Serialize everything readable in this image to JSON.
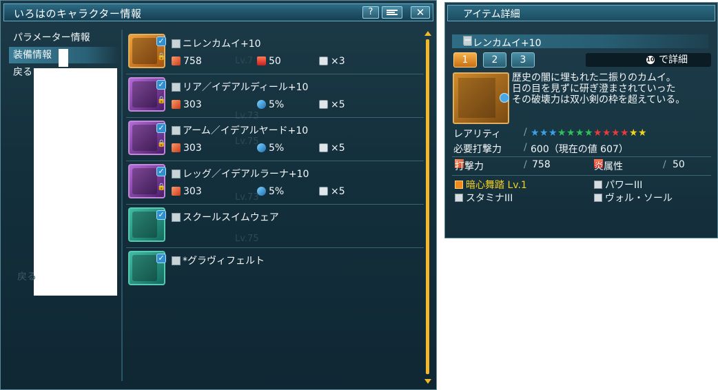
{
  "left_window": {
    "title": "いろはのキャラクター情報",
    "buttons": {
      "help": "?",
      "close": "✕"
    },
    "menu": [
      {
        "label": "パラメーター情報"
      },
      {
        "label": "装備情報"
      },
      {
        "label": "戻る"
      }
    ],
    "ghost_back": "戻る",
    "equipment": [
      {
        "name": "ニレンカムイ+10",
        "icon": "katana-icon",
        "frame": "orange",
        "stats": {
          "attack": "758",
          "element_value": "50",
          "slots": "×3"
        },
        "element_icon": "fire-icon"
      },
      {
        "name": "リア／イデアルディール+10",
        "icon": "rear-unit-icon",
        "frame": "purple",
        "stats": {
          "attack": "303",
          "element_value": "5%",
          "slots": "×5"
        },
        "element_icon": "resist-icon"
      },
      {
        "name": "アーム／イデアルヤード+10",
        "icon": "arm-unit-icon",
        "frame": "purple",
        "stats": {
          "attack": "303",
          "element_value": "5%",
          "slots": "×5"
        },
        "element_icon": "resist-icon"
      },
      {
        "name": "レッグ／イデアルラーナ+10",
        "icon": "leg-unit-icon",
        "frame": "purple",
        "stats": {
          "attack": "303",
          "element_value": "5%",
          "slots": "×5"
        },
        "element_icon": "resist-icon"
      },
      {
        "name": "スクールスイムウェア",
        "icon": "costume-icon",
        "frame": "teal"
      },
      {
        "name": "*グラヴィフェルト",
        "icon": "mag-icon",
        "frame": "teal"
      }
    ],
    "bg_levels": [
      "Lv.7",
      "Lv.73",
      "Lv.75",
      "Lv.73",
      "Lv.75"
    ]
  },
  "detail_window": {
    "title": "アイテム詳細",
    "item_name": "ニレンカムイ+10",
    "tabs": [
      "1",
      "2",
      "3"
    ],
    "detail_hint": "で詳細",
    "detail_badge": "10",
    "description": [
      "歴史の闇に埋もれた二振りのカムイ。",
      "日の目を見ずに研ぎ澄まされていった",
      "その破壊力は双小剣の枠を超えている。"
    ],
    "rarity_label": "レアリティ",
    "rarity": 13,
    "rarity_star_colors": [
      "#3aa0e8",
      "#3aa0e8",
      "#3aa0e8",
      "#2fc05a",
      "#2fc05a",
      "#2fc05a",
      "#2fc05a",
      "#e83a3a",
      "#e83a3a",
      "#e83a3a",
      "#e83a3a",
      "#f2d21e",
      "#f2d21e"
    ],
    "required_label": "必要打撃力",
    "required_value": "600（現在の値 607）",
    "attack_label": "打撃力",
    "attack_value": "758",
    "element_label": "炎属性",
    "element_value": "50",
    "abilities": [
      {
        "label": "暗心舞踏 Lv.1",
        "special": true
      },
      {
        "label": "パワーIII"
      },
      {
        "label": "スタミナIII"
      },
      {
        "label": "ヴォル・ソール"
      }
    ]
  }
}
